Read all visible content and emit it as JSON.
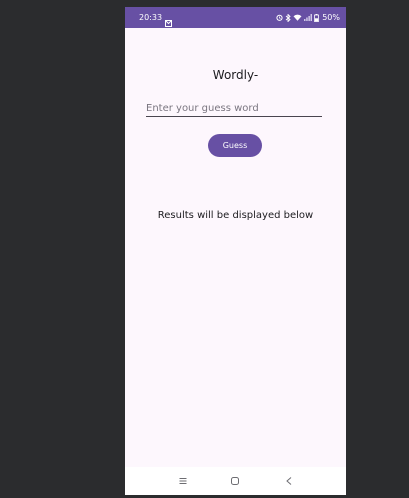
{
  "status_bar": {
    "time": "20:33",
    "battery": "50%",
    "background_color": "#6750a4",
    "icons": [
      "notification-icon",
      "alarm-icon",
      "bluetooth-icon",
      "wifi-icon",
      "signal-icon",
      "battery-icon"
    ]
  },
  "app": {
    "title": "Wordly-",
    "input_placeholder": "Enter your guess word",
    "input_value": "",
    "guess_button_label": "Guess",
    "results_text": "Results will be displayed below",
    "accent_color": "#6750a4",
    "background_color": "#fdf7fd"
  },
  "nav_bar": {
    "icons": [
      "recents-icon",
      "home-icon",
      "back-icon"
    ]
  }
}
